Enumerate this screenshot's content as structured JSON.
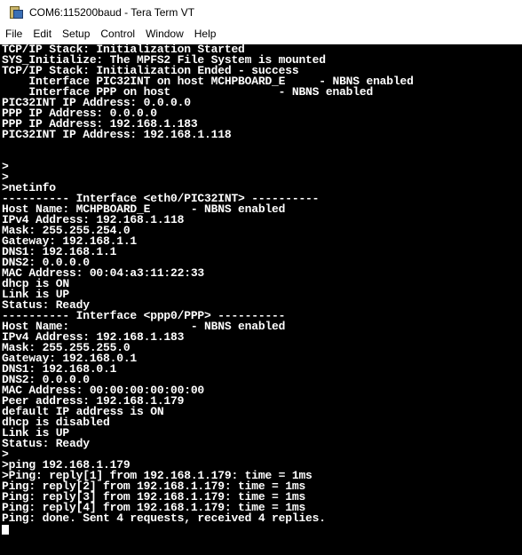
{
  "window": {
    "title": "COM6:115200baud - Tera Term VT"
  },
  "menu": {
    "items": [
      "File",
      "Edit",
      "Setup",
      "Control",
      "Window",
      "Help"
    ]
  },
  "terminal": {
    "lines": [
      "TCP/IP Stack: Initialization Started",
      "SYS_Initialize: The MPFS2 File System is mounted",
      "TCP/IP Stack: Initialization Ended - success",
      "    Interface PIC32INT on host MCHPBOARD_E     - NBNS enabled",
      "    Interface PPP on host                - NBNS enabled",
      "PIC32INT IP Address: 0.0.0.0",
      "PPP IP Address: 0.0.0.0",
      "PPP IP Address: 192.168.1.183",
      "PIC32INT IP Address: 192.168.1.118",
      "",
      "",
      ">",
      ">",
      ">netinfo",
      "---------- Interface <eth0/PIC32INT> ----------",
      "Host Name: MCHPBOARD_E      - NBNS enabled",
      "IPv4 Address: 192.168.1.118",
      "Mask: 255.255.254.0",
      "Gateway: 192.168.1.1",
      "DNS1: 192.168.1.1",
      "DNS2: 0.0.0.0",
      "MAC Address: 00:04:a3:11:22:33",
      "dhcp is ON",
      "Link is UP",
      "Status: Ready",
      "---------- Interface <ppp0/PPP> ----------",
      "Host Name:                  - NBNS enabled",
      "IPv4 Address: 192.168.1.183",
      "Mask: 255.255.255.0",
      "Gateway: 192.168.0.1",
      "DNS1: 192.168.0.1",
      "DNS2: 0.0.0.0",
      "MAC Address: 00:00:00:00:00:00",
      "Peer address: 192.168.1.179",
      "default IP address is ON",
      "dhcp is disabled",
      "Link is UP",
      "Status: Ready",
      ">",
      ">ping 192.168.1.179",
      ">Ping: reply[1] from 192.168.1.179: time = 1ms",
      "Ping: reply[2] from 192.168.1.179: time = 1ms",
      "Ping: reply[3] from 192.168.1.179: time = 1ms",
      "Ping: reply[4] from 192.168.1.179: time = 1ms",
      "Ping: done. Sent 4 requests, received 4 replies."
    ]
  },
  "colors": {
    "terminal_background": "#000000",
    "terminal_foreground": "#ffffff"
  }
}
